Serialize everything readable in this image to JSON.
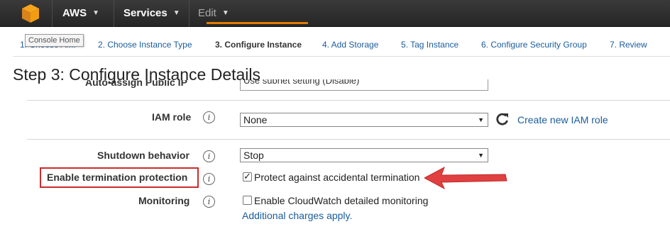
{
  "topbar": {
    "brand_label": "AWS",
    "services_label": "Services",
    "edit_label": "Edit",
    "caret": "⌄"
  },
  "tooltip": "Console Home",
  "steps": [
    {
      "label": "1. Choose AMI"
    },
    {
      "label": "2. Choose Instance Type"
    },
    {
      "label": "3. Configure Instance"
    },
    {
      "label": "4. Add Storage"
    },
    {
      "label": "5. Tag Instance"
    },
    {
      "label": "6. Configure Security Group"
    },
    {
      "label": "7. Review"
    }
  ],
  "active_step": 3,
  "page_title": "Step 3: Configure Instance Details",
  "form": {
    "auto_assign": {
      "label": "Auto-assign Public IP",
      "value": "Use subnet setting (Disable)"
    },
    "iam_role": {
      "label": "IAM role",
      "value": "None",
      "link": "Create new IAM role"
    },
    "shutdown": {
      "label": "Shutdown behavior",
      "value": "Stop"
    },
    "termination": {
      "label": "Enable termination protection",
      "checkbox_label": "Protect against accidental termination",
      "checked": true
    },
    "monitoring": {
      "label": "Monitoring",
      "checkbox_label": "Enable CloudWatch detailed monitoring",
      "checked": false,
      "note": "Additional charges apply."
    }
  },
  "info_glyph": "i",
  "refresh_glyph": "C",
  "colors": {
    "highlight": "#cc2b2b",
    "accent": "#e07b00",
    "link": "#1a5c9c",
    "arrow": "#e04040"
  }
}
